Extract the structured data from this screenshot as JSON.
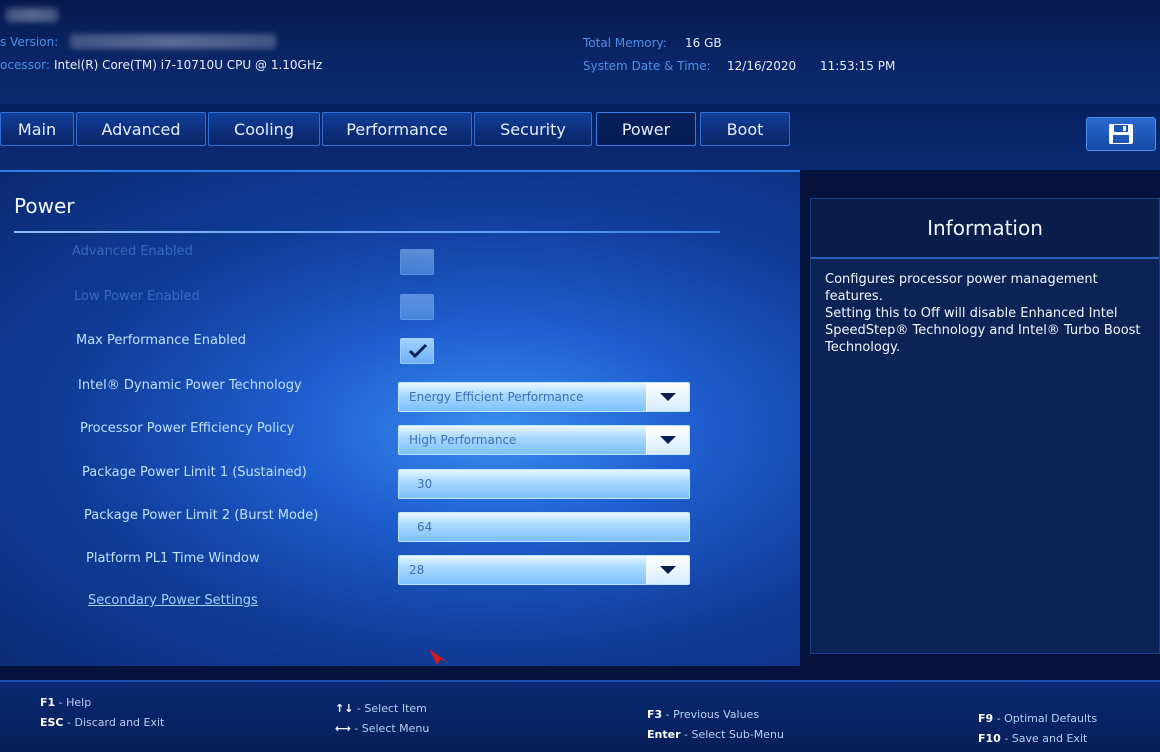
{
  "header": {
    "bios_version_label": "s Version:",
    "processor_label": "ocessor:",
    "processor_value": "Intel(R) Core(TM) i7-10710U CPU @ 1.10GHz",
    "total_memory_label": "Total Memory:",
    "total_memory_value": "16 GB",
    "datetime_label": "System Date & Time:",
    "date_value": "12/16/2020",
    "time_value": "11:53:15 PM"
  },
  "tabs": [
    {
      "label": "Main"
    },
    {
      "label": "Advanced"
    },
    {
      "label": "Cooling"
    },
    {
      "label": "Performance"
    },
    {
      "label": "Security"
    },
    {
      "label": "Power"
    },
    {
      "label": "Boot"
    }
  ],
  "active_tab": "Power",
  "save_icon": "floppy-disk-icon",
  "page": {
    "title": "Power",
    "options": [
      {
        "label": "Advanced Enabled",
        "type": "checkbox",
        "checked": false,
        "disabled": true
      },
      {
        "label": "Low Power Enabled",
        "type": "checkbox",
        "checked": false,
        "disabled": true
      },
      {
        "label": "Max Performance Enabled",
        "type": "checkbox",
        "checked": true,
        "disabled": false
      },
      {
        "label": "Intel® Dynamic Power Technology",
        "type": "select",
        "value": "Energy Efficient Performance"
      },
      {
        "label": "Processor Power Efficiency Policy",
        "type": "select",
        "value": "High Performance"
      },
      {
        "label": "Package Power Limit 1 (Sustained)",
        "type": "input",
        "value": "30"
      },
      {
        "label": "Package Power Limit 2 (Burst Mode)",
        "type": "input",
        "value": "64"
      },
      {
        "label": "Platform PL1 Time Window",
        "type": "select",
        "value": "28"
      }
    ],
    "link_label": "Secondary Power Settings"
  },
  "info": {
    "title": "Information",
    "line1": "Configures processor power management features.",
    "line2": "Setting this to Off will disable Enhanced Intel SpeedStep® Technology and Intel® Turbo Boost Technology."
  },
  "footer": {
    "f1_key": "F1",
    "f1_desc": " - Help",
    "esc_key": "ESC",
    "esc_desc": " - Discard and Exit",
    "arrows_ud_key": "↑↓",
    "arrows_ud_desc": " - Select Item",
    "arrows_lr_key": "⟷",
    "arrows_lr_desc": " - Select Menu",
    "f3_key": "F3",
    "f3_desc": " - Previous Values",
    "enter_key": "Enter",
    "enter_desc": " - Select Sub-Menu",
    "f9_key": "F9",
    "f9_desc": " - Optimal Defaults",
    "f10_key": "F10",
    "f10_desc": " - Save and Exit"
  },
  "colors": {
    "accent": "#2e7ae6",
    "panel_bg": "#0c2356",
    "label": "#bfe0ff"
  }
}
